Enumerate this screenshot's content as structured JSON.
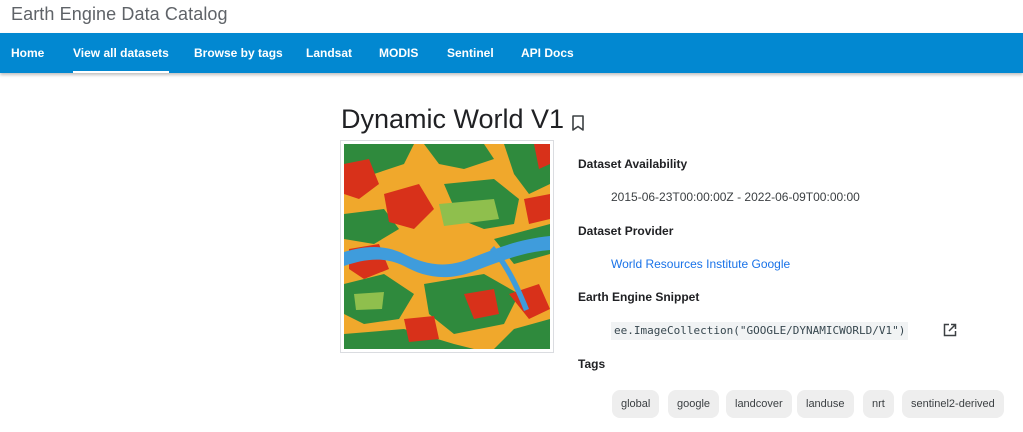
{
  "header": {
    "site_title": "Earth Engine Data Catalog"
  },
  "nav": {
    "items": [
      {
        "label": "Home"
      },
      {
        "label": "View all datasets",
        "active": true
      },
      {
        "label": "Browse by tags"
      },
      {
        "label": "Landsat"
      },
      {
        "label": "MODIS"
      },
      {
        "label": "Sentinel"
      },
      {
        "label": "API Docs"
      }
    ],
    "color": "#0288d1"
  },
  "dataset": {
    "title": "Dynamic World V1",
    "availability_label": "Dataset Availability",
    "availability_value": "2015-06-23T00:00:00Z - 2022-06-09T00:00:00",
    "provider_label": "Dataset Provider",
    "provider_value": "World Resources Institute Google",
    "snippet_label": "Earth Engine Snippet",
    "snippet_value": "ee.ImageCollection(\"GOOGLE/DYNAMICWORLD/V1\")",
    "tags_label": "Tags",
    "tags": [
      "global",
      "google",
      "landcover",
      "landuse",
      "nrt",
      "sentinel2-derived"
    ]
  },
  "icons": {
    "bookmark": "bookmark-icon",
    "open_in_new": "open-in-new-icon"
  },
  "colors": {
    "link": "#1a73e8",
    "water": "#3f9cdc",
    "trees": "#2f8a3d",
    "crops": "#f0a82c",
    "built": "#d8311a"
  }
}
